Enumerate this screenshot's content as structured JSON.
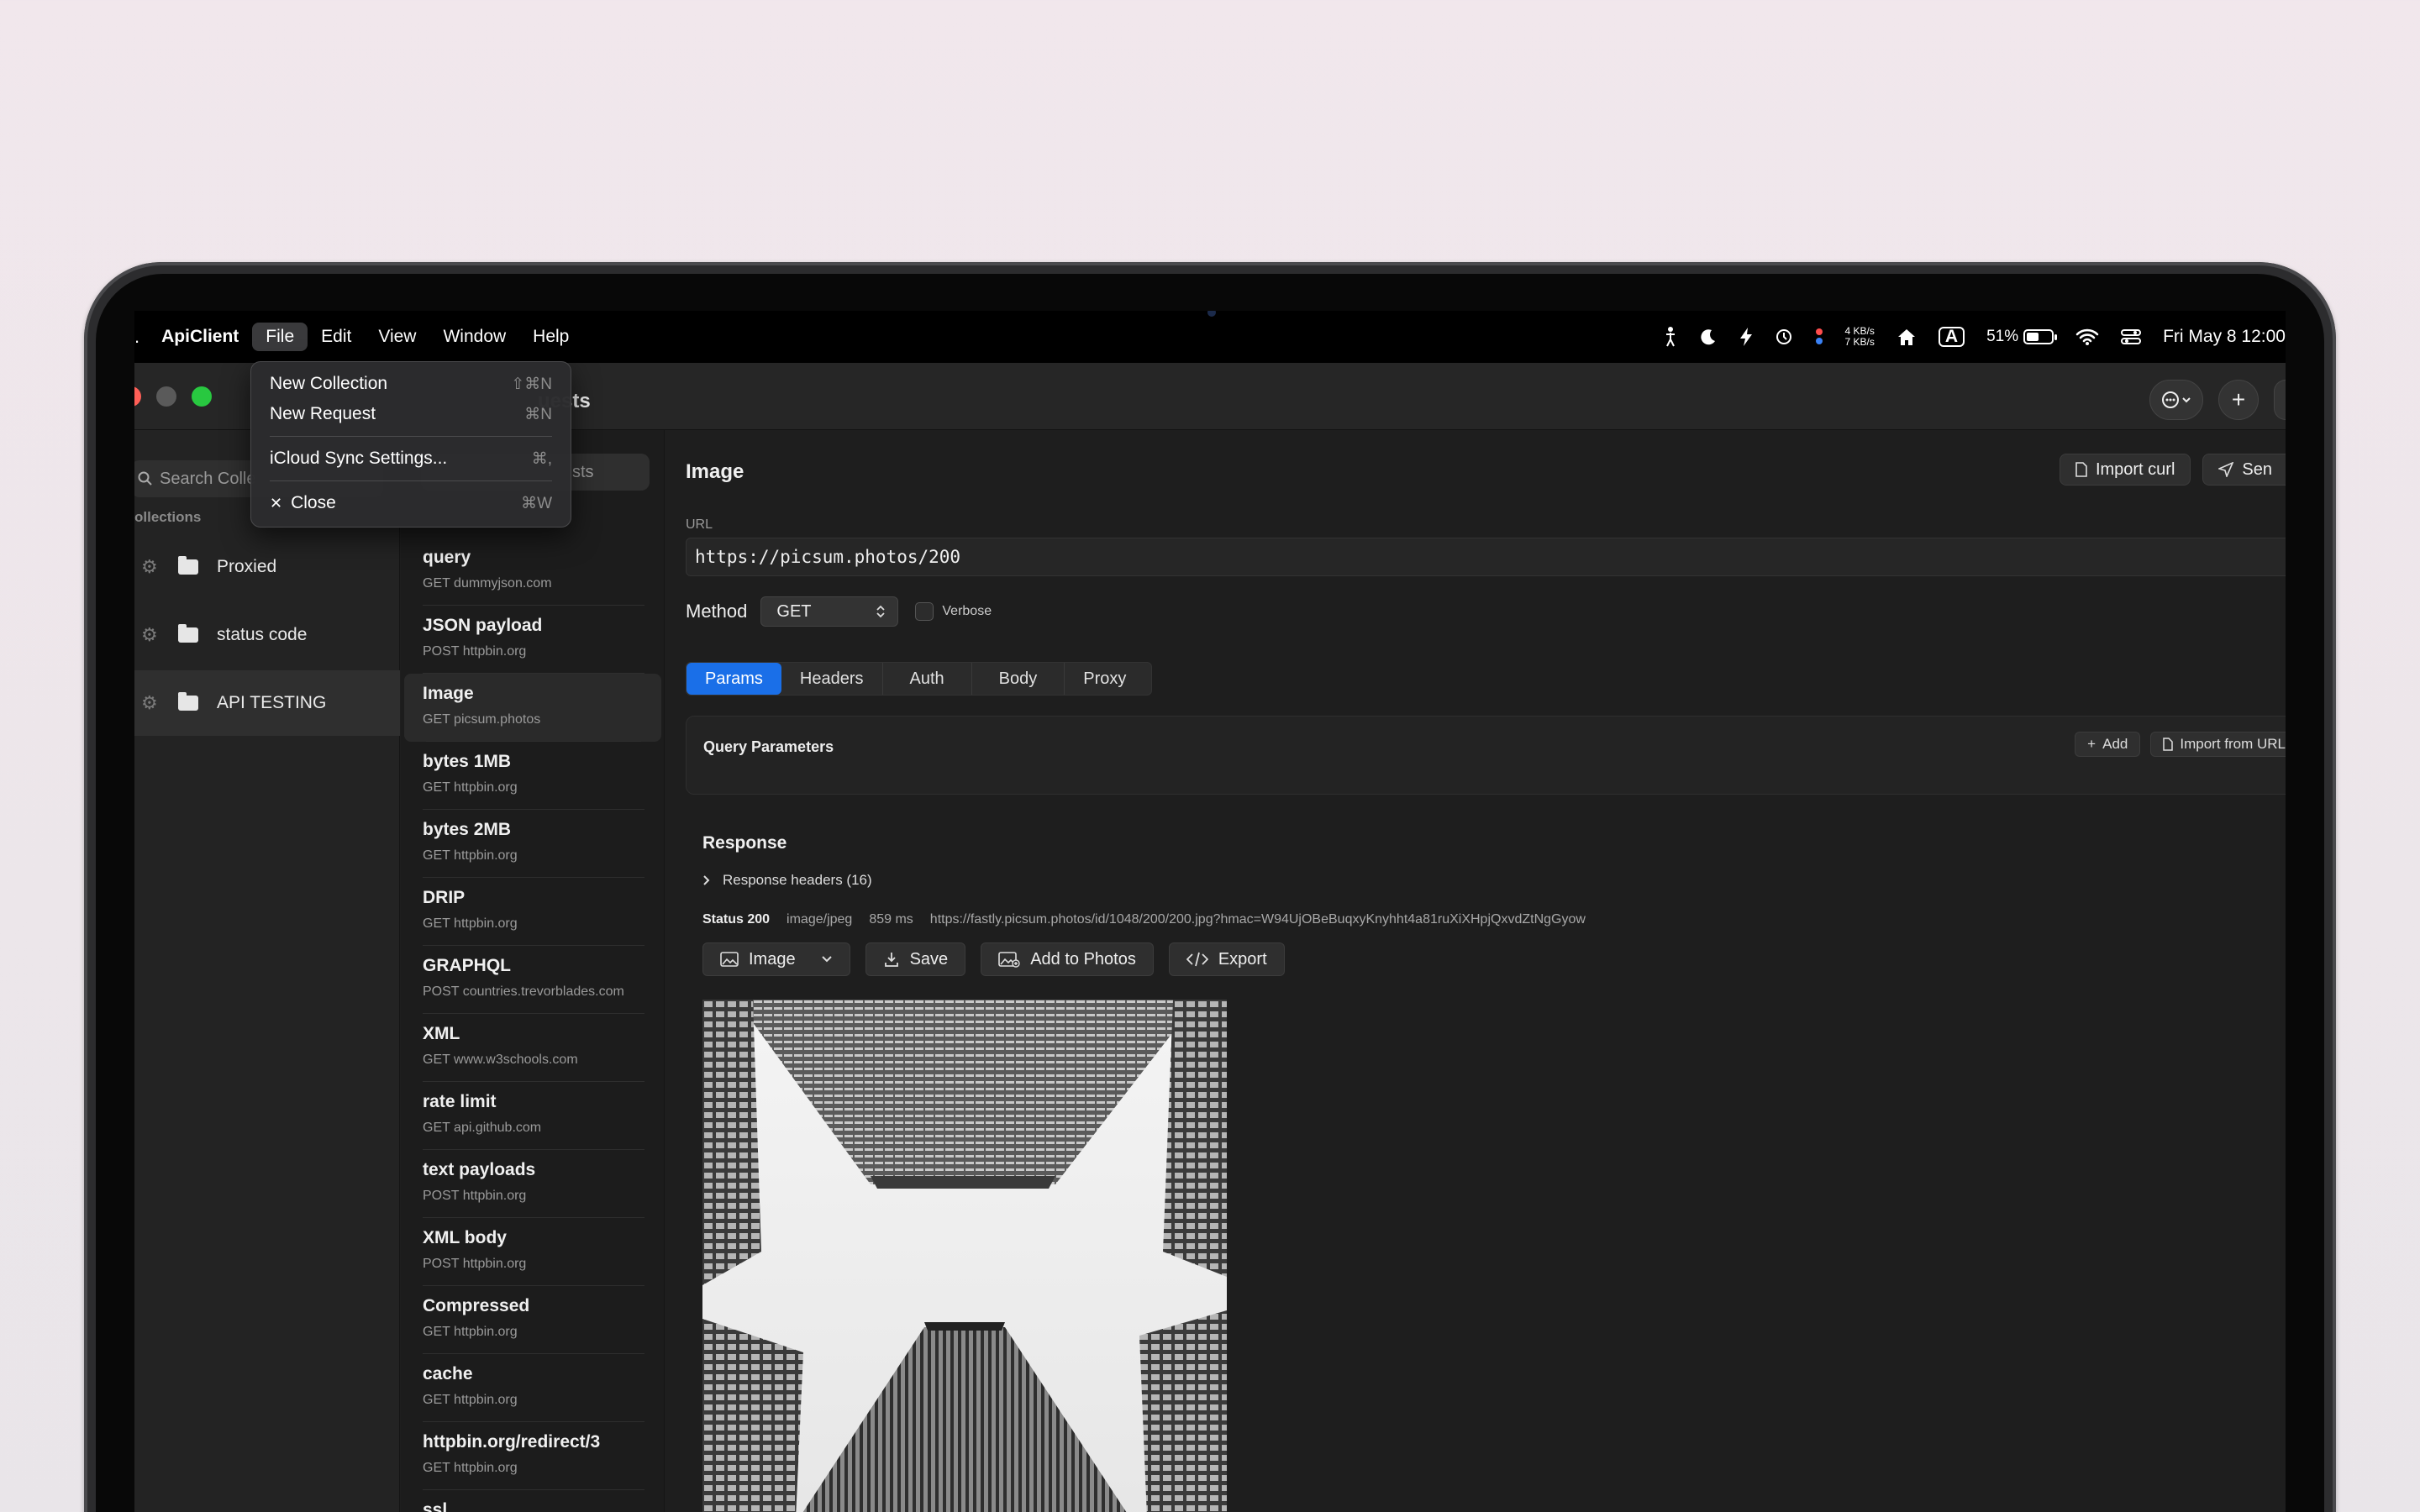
{
  "menubar": {
    "apple_glyph": ".",
    "app_name": "ApiClient",
    "menus": [
      "File",
      "Edit",
      "View",
      "Window",
      "Help"
    ],
    "net_up": "4 KB/s",
    "net_down": "7 KB/s",
    "input_source": "A",
    "battery_text": "51%",
    "battery_level": 0.51,
    "datetime": "Fri May 8  12:00"
  },
  "file_menu": {
    "items": [
      {
        "label": "New Collection",
        "shortcut": "⇧⌘N"
      },
      {
        "label": "New Request",
        "shortcut": "⌘N"
      },
      {
        "label": "iCloud Sync Settings...",
        "shortcut": "⌘,"
      },
      {
        "label": "Close",
        "shortcut": "⌘W"
      }
    ]
  },
  "window": {
    "title_fragment": "uests",
    "more_glyph": "⋯",
    "add_glyph": "+"
  },
  "sidebar": {
    "search_placeholder": "Search Colle",
    "header": "ollections",
    "collections": [
      {
        "name": "Proxied"
      },
      {
        "name": "status code"
      },
      {
        "name": "API TESTING"
      }
    ]
  },
  "requests": {
    "search_placeholder": "sts",
    "items": [
      {
        "name": "query",
        "meta": "GET dummyjson.com"
      },
      {
        "name": "JSON payload",
        "meta": "POST httpbin.org"
      },
      {
        "name": "Image",
        "meta": "GET picsum.photos"
      },
      {
        "name": "bytes 1MB",
        "meta": "GET httpbin.org"
      },
      {
        "name": "bytes 2MB",
        "meta": "GET httpbin.org"
      },
      {
        "name": "DRIP",
        "meta": "GET httpbin.org"
      },
      {
        "name": "GRAPHQL",
        "meta": "POST countries.trevorblades.com"
      },
      {
        "name": "XML",
        "meta": "GET www.w3schools.com"
      },
      {
        "name": "rate limit",
        "meta": "GET api.github.com"
      },
      {
        "name": "text payloads",
        "meta": "POST httpbin.org"
      },
      {
        "name": "XML body",
        "meta": "POST httpbin.org"
      },
      {
        "name": "Compressed",
        "meta": "GET httpbin.org"
      },
      {
        "name": "cache",
        "meta": "GET httpbin.org"
      },
      {
        "name": "httpbin.org/redirect/3",
        "meta": "GET httpbin.org"
      },
      {
        "name": "ssl",
        "meta": ""
      }
    ]
  },
  "detail": {
    "title": "Image",
    "import_curl": "Import curl",
    "send": "Sen",
    "url_label": "URL",
    "url": "https://picsum.photos/200",
    "method_label": "Method",
    "method": "GET",
    "verbose_label": "Verbose",
    "tabs": [
      "Params",
      "Headers",
      "Auth",
      "Body",
      "Proxy"
    ],
    "query_params_title": "Query Parameters",
    "add_label": "Add",
    "import_url_label": "Import from URL"
  },
  "response": {
    "title": "Response",
    "headers_label": "Response headers (16)",
    "status": "Status 200",
    "content_type": "image/jpeg",
    "time": "859 ms",
    "final_url": "https://fastly.picsum.photos/id/1048/200/200.jpg?hmac=W94UjOBeBuqxyKnyhht4a81ruXiXHpjQxvdZtNgGyow",
    "view_mode": "Image",
    "save_label": "Save",
    "add_photos_label": "Add to Photos",
    "export_label": "Export"
  },
  "colors": {
    "accent": "#1a6fe8",
    "close": "#ff5f57",
    "zoom": "#28c840"
  }
}
